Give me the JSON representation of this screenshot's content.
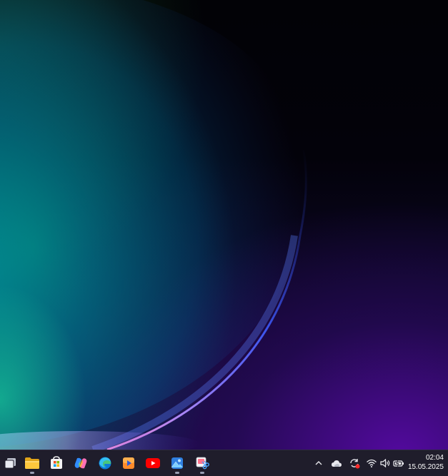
{
  "taskbar": {
    "pinned_apps": [
      {
        "name": "Task View",
        "icon": "task-view-icon",
        "running": false
      },
      {
        "name": "File Explorer",
        "icon": "folder-icon",
        "running": true
      },
      {
        "name": "Microsoft Store",
        "icon": "store-icon",
        "running": false
      },
      {
        "name": "Copilot",
        "icon": "copilot-icon",
        "running": false
      },
      {
        "name": "Microsoft Edge",
        "icon": "edge-icon",
        "running": false
      },
      {
        "name": "Media Player",
        "icon": "media-player-icon",
        "running": false
      },
      {
        "name": "YouTube",
        "icon": "youtube-icon",
        "running": false
      },
      {
        "name": "Photos",
        "icon": "photos-icon",
        "running": true
      },
      {
        "name": "Snipping Tool",
        "icon": "snipping-tool-icon",
        "running": true
      }
    ],
    "tray": {
      "icons": [
        "chevron-up-icon",
        "weather-cloud-icon",
        "sync-alert-icon",
        "wifi-icon",
        "volume-icon",
        "battery-icon"
      ]
    },
    "clock": {
      "time": "02:04",
      "date": "15.05.2025"
    }
  },
  "colors": {
    "taskbar_bg": "#1f1d2b",
    "accent_blue": "#3a6cff",
    "wallpaper_teal": "#00a0a0",
    "wallpaper_purple": "#5a12b0"
  }
}
